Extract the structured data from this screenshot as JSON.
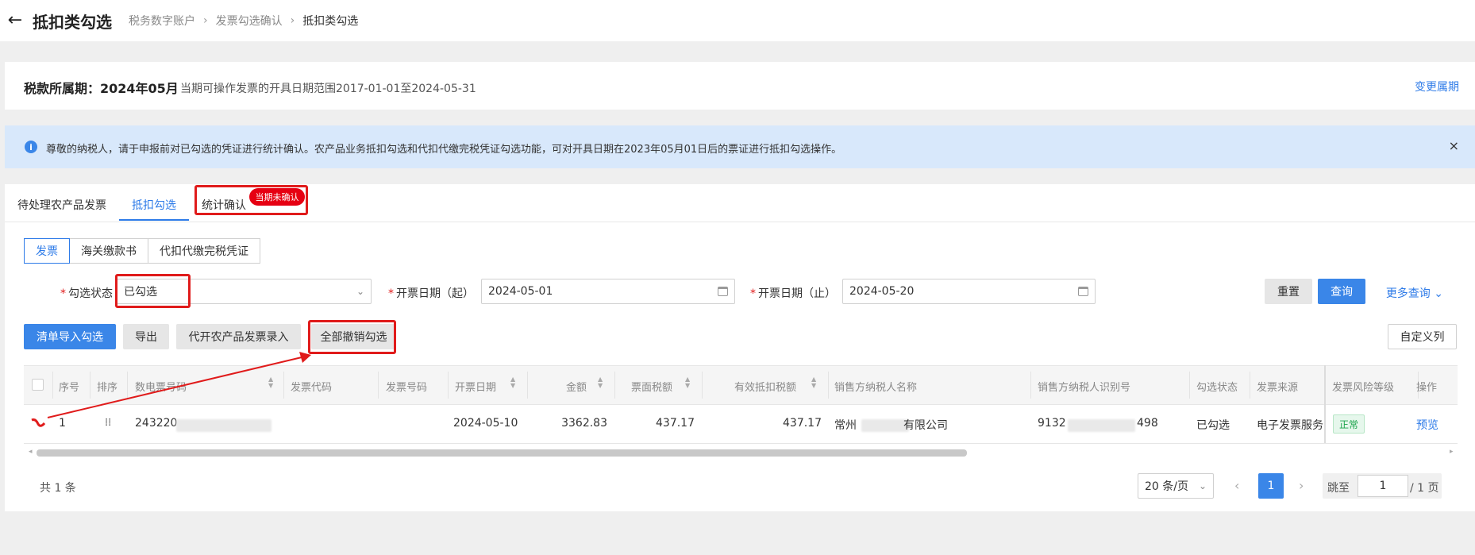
{
  "header": {
    "title": "抵扣类勾选",
    "breadcrumb": [
      "税务数字账户",
      "发票勾选确认",
      "抵扣类勾选"
    ]
  },
  "period": {
    "label": "税款所属期：2024年05月",
    "range_text": "当期可操作发票的开具日期范围2017-01-01至2024-05-31",
    "change_link": "变更属期"
  },
  "notice": {
    "text": "尊敬的纳税人，请于申报前对已勾选的凭证进行统计确认。农产品业务抵扣勾选和代扣代缴完税凭证勾选功能，可对开具日期在2023年05月01日后的票证进行抵扣勾选操作。"
  },
  "tabs": [
    {
      "label": "待处理农产品发票"
    },
    {
      "label": "抵扣勾选"
    },
    {
      "label": "统计确认",
      "badge": "当期未确认"
    }
  ],
  "segments": [
    "发票",
    "海关缴款书",
    "代扣代缴完税凭证"
  ],
  "filters": {
    "status": {
      "label": "勾选状态",
      "value": "已勾选"
    },
    "date_start": {
      "label": "开票日期（起）",
      "value": "2024-05-01"
    },
    "date_end": {
      "label": "开票日期（止）",
      "value": "2024-05-20"
    },
    "reset": "重置",
    "query": "查询",
    "more": "更多查询"
  },
  "actions": {
    "import": "清单导入勾选",
    "export": "导出",
    "agri_entry": "代开农产品发票录入",
    "cancel_all": "全部撤销勾选",
    "custom_columns": "自定义列"
  },
  "table": {
    "columns": [
      "序号",
      "排序",
      "数电票号码",
      "发票代码",
      "发票号码",
      "开票日期",
      "金额",
      "票面税额",
      "有效抵扣税额",
      "销售方纳税人名称",
      "销售方纳税人识别号",
      "勾选状态",
      "发票来源",
      "发票风险等级",
      "操作"
    ],
    "rows": [
      {
        "index": "1",
        "invoice_no": "243220",
        "code": "",
        "number": "",
        "date": "2024-05-10",
        "amount": "3362.83",
        "tax": "437.17",
        "deductible": "437.17",
        "seller_prefix": "常州",
        "seller_suffix": "有限公司",
        "seller_id_prefix": "9132",
        "seller_id_suffix": "498",
        "status": "已勾选",
        "source": "电子发票服务",
        "risk": "正常",
        "action": "预览"
      }
    ]
  },
  "pagination": {
    "total": "共 1 条",
    "page_size": "20 条/页",
    "current": "1",
    "jump_label": "跳至",
    "jump_value": "1",
    "total_pages": "/ 1 页"
  },
  "colors": {
    "primary": "#3a86e8",
    "annotation": "#e01b1b",
    "badge": "#e60012",
    "success": "#1aa34a"
  }
}
